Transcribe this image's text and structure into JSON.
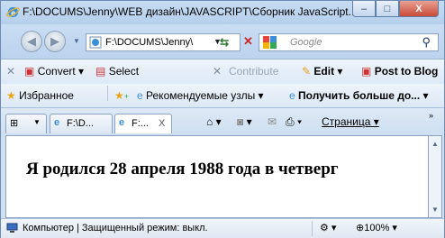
{
  "window": {
    "title": "F:\\DOCUMS\\Jenny\\WEB дизайн\\JAVASCRIPT\\Сборник JavaScript...",
    "minimize": "–",
    "maximize": "□",
    "close": "X"
  },
  "nav": {
    "address": "F:\\DOCUMS\\Jenny\\",
    "search_placeholder": "Google"
  },
  "toolbar1": {
    "convert_label": "Convert",
    "select_label": "Select",
    "contribute_label": "Contribute",
    "edit_label": "Edit",
    "post_label": "Post to Blog"
  },
  "favorites": {
    "favorites_label": "Избранное",
    "suggested_label": "Рекомендуемые узлы",
    "more_label": "Получить больше до..."
  },
  "tabs": {
    "tab1": "F:\\D...",
    "tab2": "F:...",
    "tab2_close": "X",
    "page_label": "Страница"
  },
  "content": {
    "text": "Я родился 28 апреля 1988 года в четверг"
  },
  "statusbar": {
    "text": "Компьютер | Защищенный режим: выкл.",
    "zoom": "100%"
  }
}
